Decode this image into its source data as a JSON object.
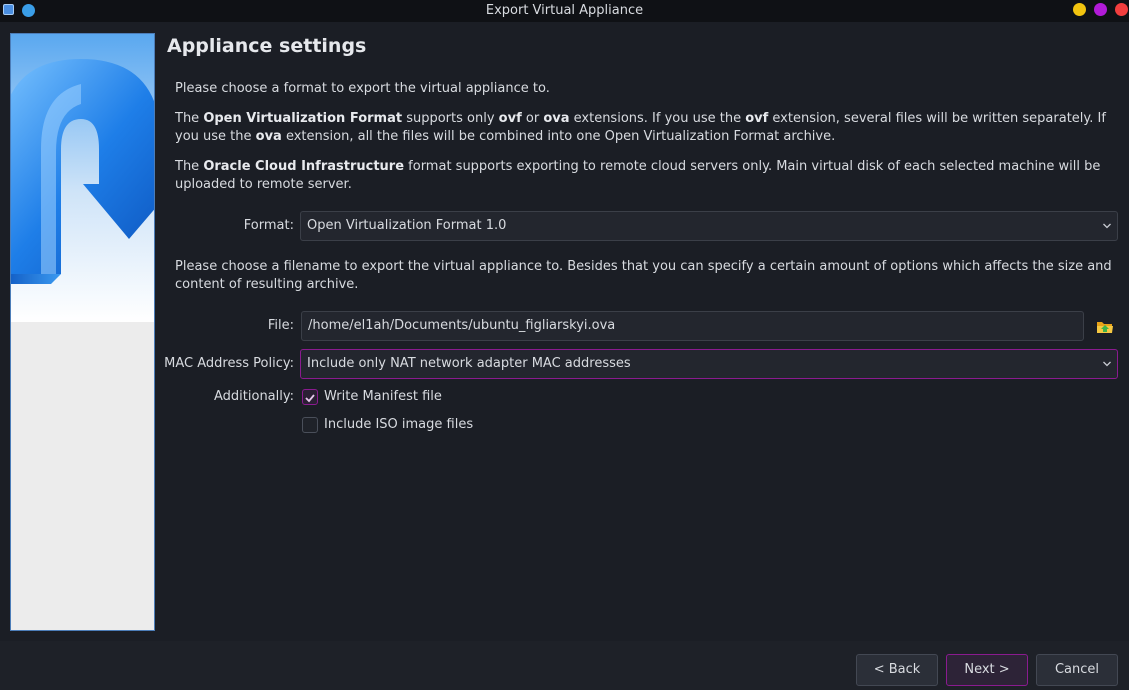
{
  "window": {
    "title": "Export Virtual Appliance"
  },
  "page": {
    "heading": "Appliance settings",
    "intro": "Please choose a format to export the virtual appliance to.",
    "ovf_para": {
      "p1": "The ",
      "b1": "Open Virtualization Format",
      "p2": " supports only ",
      "b2": "ovf",
      "p3": " or ",
      "b3": "ova",
      "p4": " extensions. If you use the ",
      "b4": "ovf",
      "p5": " extension, several files will be written separately. If you use the ",
      "b5": "ova",
      "p6": " extension, all the files will be combined into one Open Virtualization Format archive."
    },
    "oci_para": {
      "p1": "The ",
      "b1": "Oracle Cloud Infrastructure",
      "p2": " format supports exporting to remote cloud servers only. Main virtual disk of each selected machine will be uploaded to remote server."
    },
    "filename_para": "Please choose a filename to export the virtual appliance to. Besides that you can specify a certain amount of options which affects the size and content of resulting archive."
  },
  "form": {
    "format_label": "Format:",
    "format_value": "Open Virtualization Format 1.0",
    "file_label": "File:",
    "file_value": "/home/el1ah/Documents/ubuntu_figliarskyi.ova",
    "mac_label": "MAC Address Policy:",
    "mac_value": "Include only NAT network adapter MAC addresses",
    "additionally_label": "Additionally:",
    "manifest_label": "Write Manifest file",
    "manifest_checked": true,
    "iso_label": "Include ISO image files",
    "iso_checked": false
  },
  "buttons": {
    "back": "< Back",
    "next": "Next >",
    "cancel": "Cancel"
  },
  "icons": {
    "app": "virtualbox-app-icon",
    "pin": "pin-icon",
    "folder": "folder-open-icon",
    "chevron": "chevron-down-icon",
    "check": "checkmark-icon"
  },
  "colors": {
    "accent": "#8a1b8f",
    "background": "#1b1e25",
    "minimize": "#f2c40f",
    "maximize": "#b21bd8",
    "close": "#f23e3e"
  }
}
